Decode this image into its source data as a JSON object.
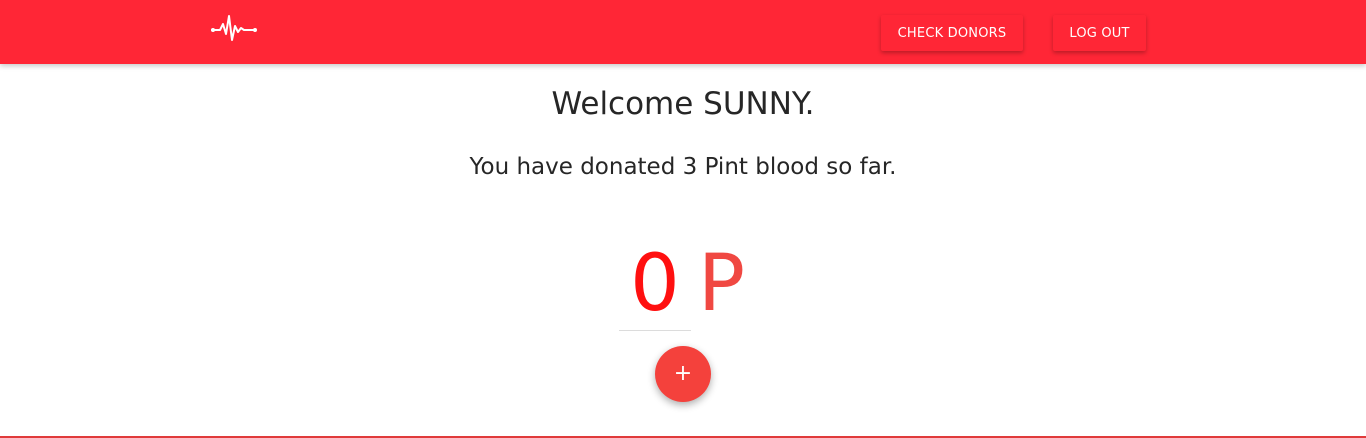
{
  "header": {
    "logo_icon": "heartbeat-icon",
    "buttons": {
      "check_donors": "CHECK DONORS",
      "log_out": "LOG OUT"
    }
  },
  "main": {
    "welcome": "Welcome SUNNY.",
    "donated_text": "You have donated 3 Pint blood so far.",
    "pint_input_value": "0",
    "unit_label": "P",
    "add_button_label": "+"
  },
  "colors": {
    "brand_red": "#ff2636",
    "fab_red": "#f4413c",
    "value_red": "#ff1010"
  }
}
